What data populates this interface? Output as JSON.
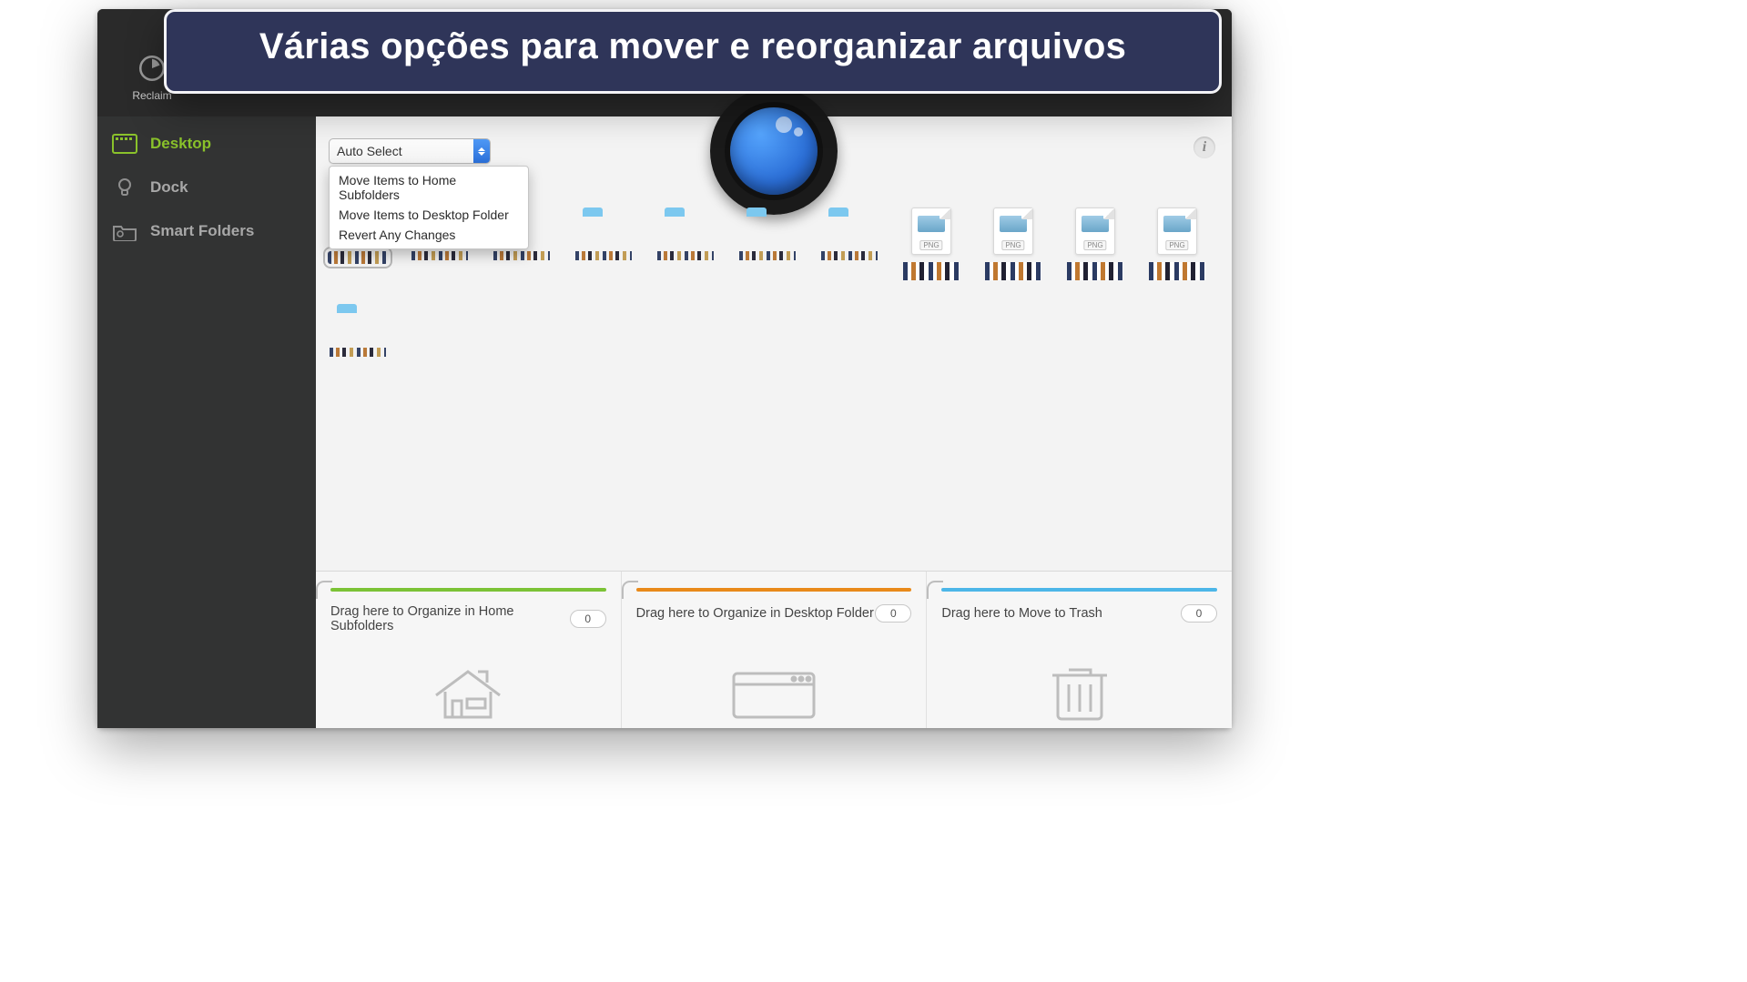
{
  "callout": {
    "text": "Várias opções para mover e reorganizar arquivos"
  },
  "toolbar": {
    "reclaim_label": "Reclaim"
  },
  "sidebar": {
    "items": [
      {
        "label": "Desktop",
        "icon": "desktop-grid-icon",
        "active": true
      },
      {
        "label": "Dock",
        "icon": "lightbulb-icon",
        "active": false
      },
      {
        "label": "Smart Folders",
        "icon": "gear-folder-icon",
        "active": false
      }
    ]
  },
  "select": {
    "value": "Auto Select",
    "options": [
      "Move Items to Home Subfolders",
      "Move Items to Desktop Folder",
      "Revert Any Changes"
    ]
  },
  "files": {
    "png_badge": "PNG",
    "items": [
      {
        "type": "folder",
        "selected": true
      },
      {
        "type": "folder"
      },
      {
        "type": "folder"
      },
      {
        "type": "folder"
      },
      {
        "type": "folder"
      },
      {
        "type": "folder"
      },
      {
        "type": "folder"
      },
      {
        "type": "png"
      },
      {
        "type": "png"
      },
      {
        "type": "png"
      },
      {
        "type": "png"
      },
      {
        "type": "folder"
      }
    ]
  },
  "dropzones": [
    {
      "label": "Drag here to Organize in Home Subfolders",
      "count": "0",
      "color": "#7cc336",
      "icon": "house"
    },
    {
      "label": "Drag here to Organize in Desktop Folder",
      "count": "0",
      "color": "#e98a1a",
      "icon": "desktop"
    },
    {
      "label": "Drag here to Move to Trash",
      "count": "0",
      "color": "#4cb6e8",
      "icon": "trash"
    }
  ]
}
